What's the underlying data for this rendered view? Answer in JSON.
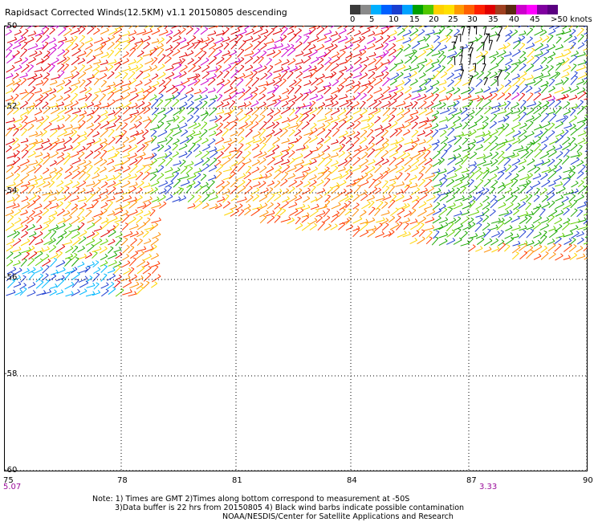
{
  "header": {
    "title": "Rapidsact Corrected Winds(12.5KM) v1.1 20150805 descending"
  },
  "legend": {
    "colors": [
      "#3a3a3a",
      "#8a8a8a",
      "#00b0ff",
      "#0060ff",
      "#1a3fd0",
      "#00a2ff",
      "#00a000",
      "#50c800",
      "#ffd000",
      "#ffe000",
      "#ff9a00",
      "#ff6000",
      "#ff2000",
      "#e00000",
      "#a04020",
      "#5a2a10",
      "#cc00cc",
      "#ff00ff",
      "#8000a0",
      "#5a0080"
    ],
    "labels": [
      "0",
      "5",
      "10",
      "15",
      "20",
      "25",
      "30",
      "35",
      "40",
      "45",
      ">50 knots"
    ]
  },
  "map": {
    "lat_labels": [
      "-50",
      "-52",
      "-54",
      "-56",
      "-58",
      "-60"
    ],
    "lon_labels": [
      "75",
      "78",
      "81",
      "84",
      "87",
      "90"
    ],
    "time_labels": [
      "5.07",
      "3.33"
    ]
  },
  "notes": {
    "line1": "Note: 1) Times are GMT 2)Times along bottom correspond to measurement at -50S",
    "line2": "3)Data buffer is 22 hrs from 20150805 4) Black wind barbs indicate possible contamination",
    "line3": "NOAA/NESDIS/Center for Satellite Applications and Research"
  }
}
